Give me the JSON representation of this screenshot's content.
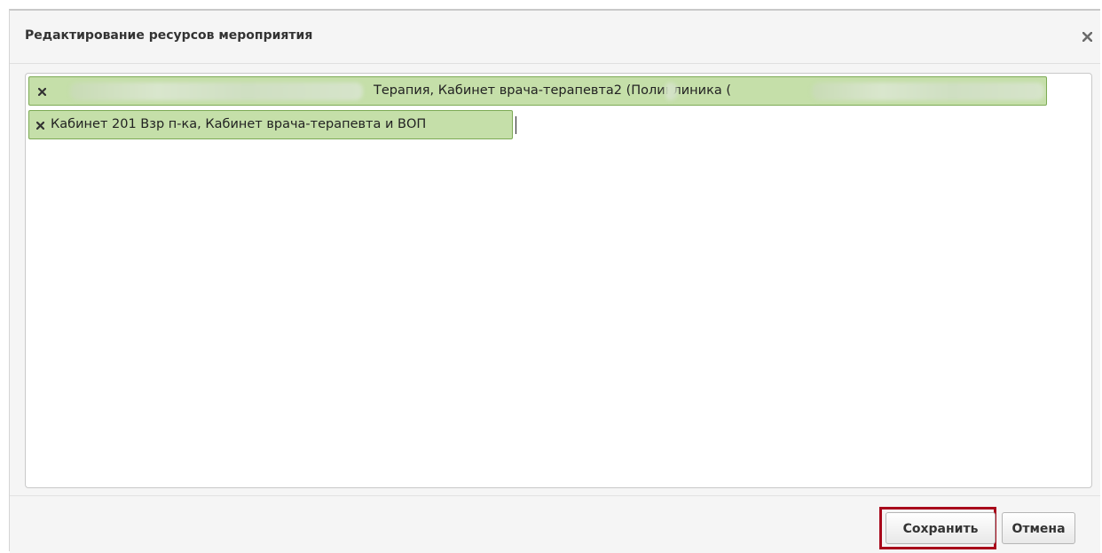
{
  "dialog": {
    "title": "Редактирование ресурсов мероприятия",
    "close_icon": "close-icon"
  },
  "resources": {
    "items": [
      {
        "label": "Терапия, Кабинет врача-терапевта2 (Поликлиника (",
        "remove_icon": "remove-icon"
      },
      {
        "label": "Кабинет 201 Взр п-ка, Кабинет врача-терапевта и ВОП",
        "remove_icon": "remove-icon"
      }
    ]
  },
  "footer": {
    "save_label": "Сохранить",
    "cancel_label": "Отмена"
  },
  "colors": {
    "tag_background": "#c5dfa9",
    "tag_border": "#7daa55",
    "highlight": "#a8081b"
  }
}
